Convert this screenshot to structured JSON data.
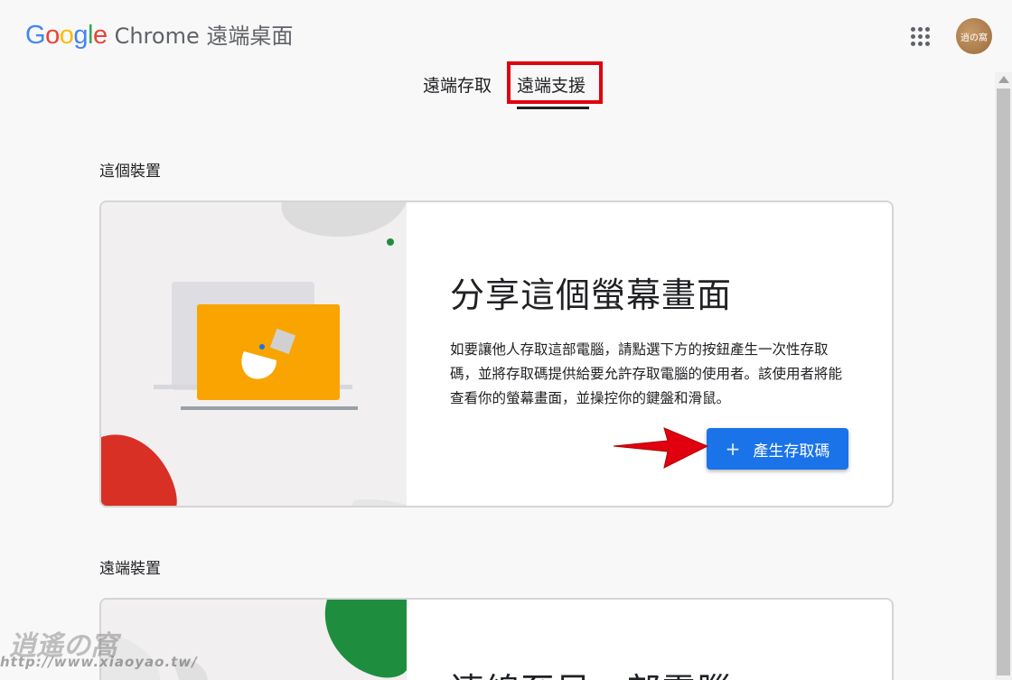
{
  "header": {
    "brand_letters": [
      "G",
      "o",
      "o",
      "g",
      "l",
      "e"
    ],
    "brand_colors": [
      "#4285F4",
      "#EA4335",
      "#FBBC05",
      "#4285F4",
      "#34A853",
      "#EA4335"
    ],
    "product": "Chrome 遠端桌面",
    "apps_icon": "apps-grid-icon",
    "avatar_text": "逍の窩"
  },
  "tabs": [
    {
      "label": "遠端存取",
      "active": false
    },
    {
      "label": "遠端支援",
      "active": true
    }
  ],
  "this_device": {
    "section_title": "這個裝置",
    "heading": "分享這個螢幕畫面",
    "description": "如要讓他人存取這部電腦，請點選下方的按鈕產生一次性存取碼，並將存取碼提供給要允許存取電腦的使用者。該使用者將能查看你的螢幕畫面，並操控你的鍵盤和滑鼠。",
    "button_icon": "+",
    "button_label": "產生存取碼"
  },
  "remote_devices": {
    "section_title": "遠端裝置",
    "heading": "連線至另一部電腦"
  },
  "watermark": {
    "text": "逍遙の窩",
    "url": "http://www.xiaoyao.tw/"
  },
  "colors": {
    "accent_blue": "#1a73e8",
    "highlight_red": "#e0000f",
    "illus_orange": "#f9a400",
    "illus_red": "#d93025",
    "illus_green": "#1e8e3e"
  }
}
